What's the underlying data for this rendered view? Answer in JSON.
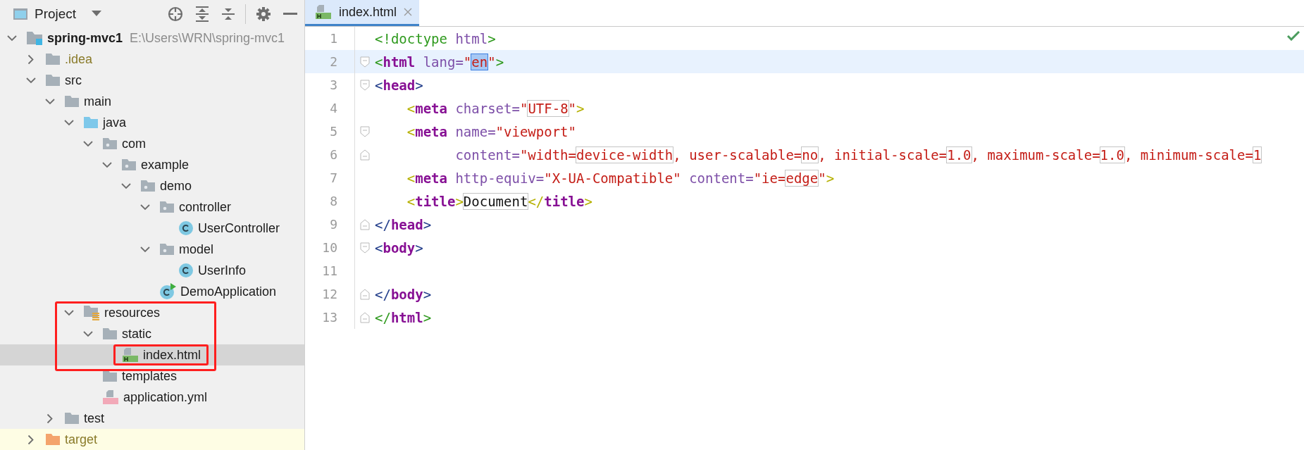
{
  "project_panel": {
    "title": "Project",
    "tree": [
      {
        "label": "spring-mvc1",
        "path": "E:\\Users\\WRN\\spring-mvc1",
        "kind": "module",
        "expanded": true,
        "selected": false,
        "highlighted": false,
        "children": [
          {
            "label": ".idea",
            "kind": "ignored-folder",
            "expanded": false,
            "selected": false,
            "highlighted": false
          },
          {
            "label": "src",
            "kind": "folder",
            "expanded": true,
            "selected": false,
            "highlighted": false,
            "children": [
              {
                "label": "main",
                "kind": "folder",
                "expanded": true,
                "selected": false,
                "highlighted": false,
                "children": [
                  {
                    "label": "java",
                    "kind": "source-folder",
                    "expanded": true,
                    "selected": false,
                    "highlighted": false,
                    "children": [
                      {
                        "label": "com",
                        "kind": "package",
                        "expanded": true,
                        "selected": false,
                        "highlighted": false,
                        "children": [
                          {
                            "label": "example",
                            "kind": "package",
                            "expanded": true,
                            "selected": false,
                            "highlighted": false,
                            "children": [
                              {
                                "label": "demo",
                                "kind": "package",
                                "expanded": true,
                                "selected": false,
                                "highlighted": false,
                                "children": [
                                  {
                                    "label": "controller",
                                    "kind": "package",
                                    "expanded": true,
                                    "selected": false,
                                    "highlighted": false,
                                    "children": [
                                      {
                                        "label": "UserController",
                                        "kind": "class",
                                        "selected": false,
                                        "highlighted": false
                                      }
                                    ]
                                  },
                                  {
                                    "label": "model",
                                    "kind": "package",
                                    "expanded": true,
                                    "selected": false,
                                    "highlighted": false,
                                    "children": [
                                      {
                                        "label": "UserInfo",
                                        "kind": "class",
                                        "selected": false,
                                        "highlighted": false
                                      }
                                    ]
                                  },
                                  {
                                    "label": "DemoApplication",
                                    "kind": "app-class",
                                    "selected": false,
                                    "highlighted": false
                                  }
                                ]
                              }
                            ]
                          }
                        ]
                      }
                    ]
                  },
                  {
                    "label": "resources",
                    "kind": "resources-folder",
                    "expanded": true,
                    "selected": false,
                    "highlighted": true,
                    "children": [
                      {
                        "label": "static",
                        "kind": "folder",
                        "expanded": true,
                        "selected": false,
                        "highlighted": false,
                        "children": [
                          {
                            "label": "index.html",
                            "kind": "html-file",
                            "selected": true,
                            "highlighted": true
                          }
                        ]
                      },
                      {
                        "label": "templates",
                        "kind": "folder",
                        "selected": false,
                        "highlighted": false
                      },
                      {
                        "label": "application.yml",
                        "kind": "yml-file",
                        "selected": false,
                        "highlighted": false
                      }
                    ]
                  }
                ]
              },
              {
                "label": "test",
                "kind": "folder",
                "expanded": false,
                "selected": false,
                "highlighted": false
              }
            ]
          },
          {
            "label": "target",
            "kind": "excluded-folder",
            "expanded": false,
            "selected": false,
            "highlighted": false
          }
        ]
      }
    ]
  },
  "editor": {
    "tabs": [
      {
        "label": "index.html",
        "selected": true
      }
    ],
    "lines": [
      {
        "number": "1",
        "current": false,
        "tokens": [
          {
            "t": "<!doctype ",
            "kind": "br-green"
          },
          {
            "t": "html",
            "kind": "attr"
          },
          {
            "t": ">",
            "kind": "br-green"
          }
        ]
      },
      {
        "number": "2",
        "current": true,
        "kind": "fold-start",
        "tokens": [
          {
            "t": "<",
            "kind": "br-green"
          },
          {
            "t": "html",
            "kind": "name"
          },
          {
            "t": " lang=",
            "kind": "attr"
          },
          {
            "t": "\"",
            "kind": "str"
          },
          {
            "t": "en",
            "kind": "str-selected"
          },
          {
            "t": "\"",
            "kind": "str"
          },
          {
            "t": ">",
            "kind": "br-green"
          }
        ]
      },
      {
        "number": "3",
        "current": false,
        "kind": "fold-start",
        "tokens": [
          {
            "t": "<",
            "kind": "br-navy"
          },
          {
            "t": "head",
            "kind": "name"
          },
          {
            "t": ">",
            "kind": "br-navy"
          }
        ]
      },
      {
        "number": "4",
        "current": false,
        "tokens": [
          {
            "t": "    <",
            "kind": "br-olive"
          },
          {
            "t": "meta",
            "kind": "name"
          },
          {
            "t": " charset=",
            "kind": "attr"
          },
          {
            "t": "\"",
            "kind": "str"
          },
          {
            "t": "UTF-8",
            "kind": "str-boxed"
          },
          {
            "t": "\"",
            "kind": "str"
          },
          {
            "t": ">",
            "kind": "br-olive"
          }
        ]
      },
      {
        "number": "5",
        "current": false,
        "kind": "fold-start",
        "tokens": [
          {
            "t": "    <",
            "kind": "br-olive"
          },
          {
            "t": "meta",
            "kind": "name"
          },
          {
            "t": " name=",
            "kind": "attr"
          },
          {
            "t": "\"viewport\"",
            "kind": "str"
          }
        ]
      },
      {
        "number": "6",
        "current": false,
        "kind": "fold-end",
        "tokens": [
          {
            "t": "          content=",
            "kind": "attr"
          },
          {
            "t": "\"width=",
            "kind": "str"
          },
          {
            "t": "device-width",
            "kind": "str-boxed"
          },
          {
            "t": ", user-scalable=",
            "kind": "str"
          },
          {
            "t": "no",
            "kind": "str-boxed"
          },
          {
            "t": ", initial-scale=",
            "kind": "str"
          },
          {
            "t": "1.0",
            "kind": "str-boxed"
          },
          {
            "t": ", maximum-scale=",
            "kind": "str"
          },
          {
            "t": "1.0",
            "kind": "str-boxed"
          },
          {
            "t": ", minimum-scale=",
            "kind": "str"
          },
          {
            "t": "1",
            "kind": "str-boxed"
          }
        ]
      },
      {
        "number": "7",
        "current": false,
        "tokens": [
          {
            "t": "    <",
            "kind": "br-olive"
          },
          {
            "t": "meta",
            "kind": "name"
          },
          {
            "t": " http-equiv=",
            "kind": "attr"
          },
          {
            "t": "\"X-UA-Compatible\"",
            "kind": "str"
          },
          {
            "t": " content=",
            "kind": "attr"
          },
          {
            "t": "\"ie=",
            "kind": "str"
          },
          {
            "t": "edge",
            "kind": "str-boxed"
          },
          {
            "t": "\"",
            "kind": "str"
          },
          {
            "t": ">",
            "kind": "br-olive"
          }
        ]
      },
      {
        "number": "8",
        "current": false,
        "tokens": [
          {
            "t": "    <",
            "kind": "br-olive"
          },
          {
            "t": "title",
            "kind": "name"
          },
          {
            "t": ">",
            "kind": "br-olive"
          },
          {
            "t": "Document",
            "kind": "text-boxed"
          },
          {
            "t": "</",
            "kind": "br-olive"
          },
          {
            "t": "title",
            "kind": "name"
          },
          {
            "t": ">",
            "kind": "br-olive"
          }
        ]
      },
      {
        "number": "9",
        "current": false,
        "kind": "fold-end",
        "tokens": [
          {
            "t": "</",
            "kind": "br-navy"
          },
          {
            "t": "head",
            "kind": "name"
          },
          {
            "t": ">",
            "kind": "br-navy"
          }
        ]
      },
      {
        "number": "10",
        "current": false,
        "kind": "fold-start",
        "tokens": [
          {
            "t": "<",
            "kind": "br-navy"
          },
          {
            "t": "body",
            "kind": "name"
          },
          {
            "t": ">",
            "kind": "br-navy"
          }
        ]
      },
      {
        "number": "11",
        "current": false
      },
      {
        "number": "12",
        "current": false,
        "kind": "fold-end",
        "tokens": [
          {
            "t": "</",
            "kind": "br-navy"
          },
          {
            "t": "body",
            "kind": "name"
          },
          {
            "t": ">",
            "kind": "br-navy"
          }
        ]
      },
      {
        "number": "13",
        "current": false,
        "kind": "fold-end",
        "tokens": [
          {
            "t": "</",
            "kind": "br-green"
          },
          {
            "t": "html",
            "kind": "name"
          },
          {
            "t": ">",
            "kind": "br-green"
          }
        ]
      }
    ]
  }
}
